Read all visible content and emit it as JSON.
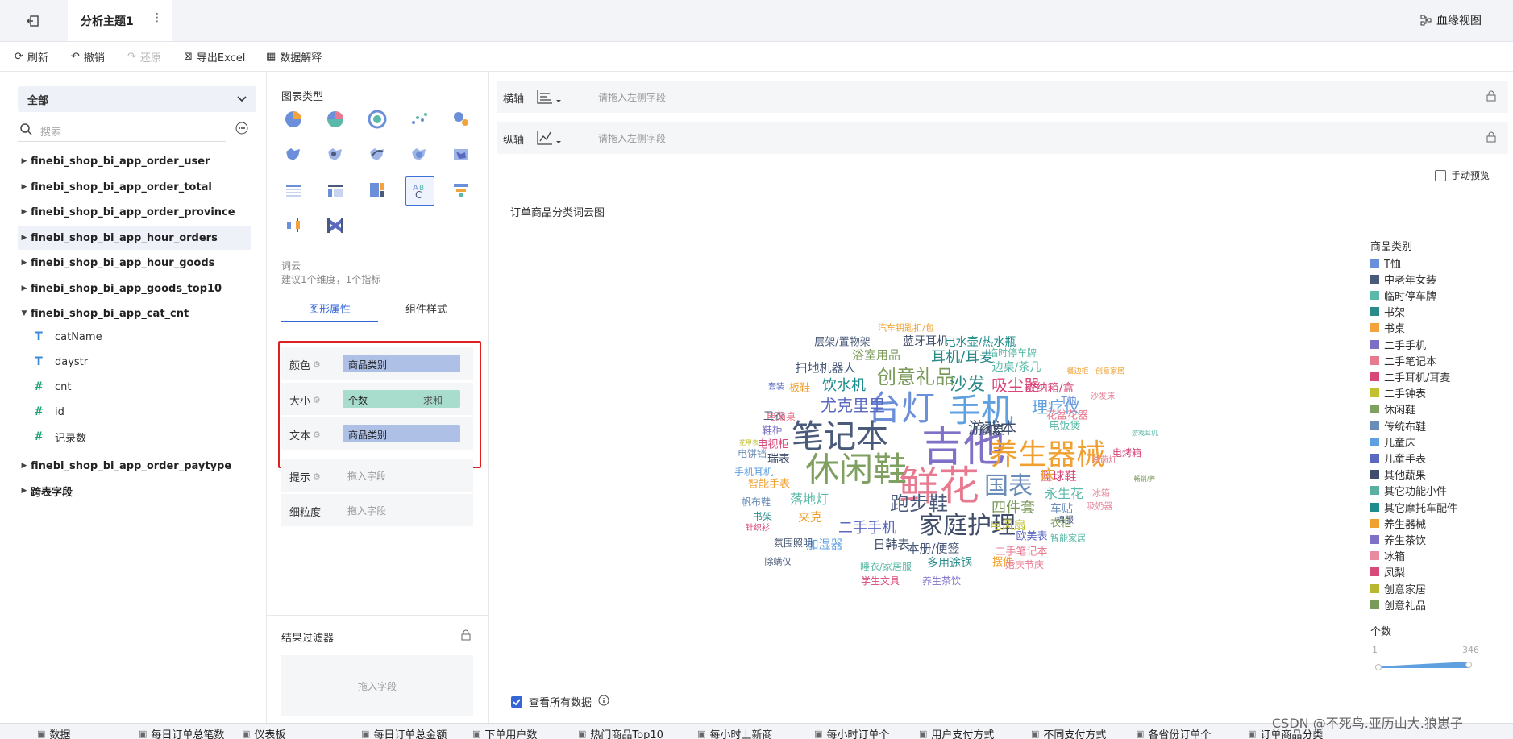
{
  "topbar": {
    "title": "分析主题1",
    "more": "⋮",
    "lineage": "血缘视图"
  },
  "toolbar": {
    "refresh": "刷新",
    "undo": "撤销",
    "redo": "还原",
    "export": "导出Excel",
    "explain": "数据解释"
  },
  "left": {
    "scope": "全部",
    "search_placeholder": "搜索",
    "tables": [
      "finebi_shop_bi_app_order_user",
      "finebi_shop_bi_app_order_total",
      "finebi_shop_bi_app_order_province",
      "finebi_shop_bi_app_hour_orders",
      "finebi_shop_bi_app_hour_goods",
      "finebi_shop_bi_app_goods_top10",
      "finebi_shop_bi_app_cat_cnt"
    ],
    "fields": [
      "catName",
      "daystr",
      "cnt",
      "id",
      "记录数"
    ],
    "tables_after": [
      "finebi_shop_bi_app_order_paytype",
      "跨表字段"
    ]
  },
  "mid": {
    "chart_type_label": "图表类型",
    "wordcloud_name": "词云",
    "wordcloud_tip": "建议1个维度，1个指标",
    "tab_props": "图形属性",
    "tab_style": "组件样式",
    "color_label": "颜色",
    "color_value": "商品类别",
    "size_label": "大小",
    "size_value": "个数",
    "size_agg": "求和",
    "text_label": "文本",
    "text_value": "商品类别",
    "tip_label": "提示",
    "tip_placeholder": "拖入字段",
    "grain_label": "细粒度",
    "grain_placeholder": "拖入字段",
    "filter_title": "结果过滤器",
    "filter_placeholder": "拖入字段"
  },
  "canvas": {
    "x_axis_label": "横轴",
    "y_axis_label": "纵轴",
    "axis_placeholder": "请拖入左侧字段",
    "manual_preview": "手动预览",
    "chart_title": "订单商品分类词云图",
    "legend_title": "商品类别",
    "size_title": "个数",
    "size_min": "1",
    "size_max": "346",
    "view_all": "查看所有数据"
  },
  "legend": [
    {
      "label": "T恤",
      "color": "#6b8fd8"
    },
    {
      "label": "中老年女装",
      "color": "#4a5a7a"
    },
    {
      "label": "临时停车牌",
      "color": "#5ab9a8"
    },
    {
      "label": "书架",
      "color": "#2a8a8a"
    },
    {
      "label": "书桌",
      "color": "#f3a33b"
    },
    {
      "label": "二手手机",
      "color": "#7a6fc4"
    },
    {
      "label": "二手笔记本",
      "color": "#e87a90"
    },
    {
      "label": "二手耳机/耳麦",
      "color": "#d9467a"
    },
    {
      "label": "二手钟表",
      "color": "#c0c030"
    },
    {
      "label": "休闲鞋",
      "color": "#7fa060"
    },
    {
      "label": "传统布鞋",
      "color": "#6a8cb8"
    },
    {
      "label": "儿童床",
      "color": "#5fa0e0"
    },
    {
      "label": "儿童手表",
      "color": "#5a68c0"
    },
    {
      "label": "其他蔬果",
      "color": "#3f4d6a"
    },
    {
      "label": "其它功能小件",
      "color": "#5ab0a0"
    },
    {
      "label": "其它摩托车配件",
      "color": "#1f8c8c"
    },
    {
      "label": "养生器械",
      "color": "#f0a030"
    },
    {
      "label": "养生茶饮",
      "color": "#8070c8"
    },
    {
      "label": "冰箱",
      "color": "#e88aa0"
    },
    {
      "label": "凤梨",
      "color": "#d84a7c"
    },
    {
      "label": "创意家居",
      "color": "#b8b830"
    },
    {
      "label": "创意礼品",
      "color": "#7a9a5a"
    }
  ],
  "wordcloud": [
    {
      "text": "吉他",
      "size": 52,
      "color": "#8070c8"
    },
    {
      "text": "鲜花",
      "size": 50,
      "color": "#e87a90"
    },
    {
      "text": "台灯",
      "size": 42,
      "color": "#6b8fd8"
    },
    {
      "text": "手机",
      "size": 40,
      "color": "#5fa0e0"
    },
    {
      "text": "休闲鞋",
      "size": 42,
      "color": "#7fa060"
    },
    {
      "text": "笔记本",
      "size": 40,
      "color": "#4a5a7a"
    },
    {
      "text": "养生器械",
      "size": 36,
      "color": "#f0a030"
    },
    {
      "text": "家庭护理",
      "size": 30,
      "color": "#3f4d6a"
    },
    {
      "text": "国表",
      "size": 30,
      "color": "#6a8cb8"
    },
    {
      "text": "跑步鞋",
      "size": 24,
      "color": "#4a5a7a"
    },
    {
      "text": "创意礼品",
      "size": 24,
      "color": "#7a9a5a"
    },
    {
      "text": "尤克里里",
      "size": 20,
      "color": "#5a68c0"
    },
    {
      "text": "沙发",
      "size": 22,
      "color": "#2a8a8a"
    },
    {
      "text": "吸尘器",
      "size": 20,
      "color": "#d9467a"
    },
    {
      "text": "游戏本",
      "size": 20,
      "color": "#3f4d6a"
    },
    {
      "text": "理疗仪",
      "size": 20,
      "color": "#5fa0e0"
    },
    {
      "text": "耳机/耳麦",
      "size": 18,
      "color": "#2a8a8a"
    },
    {
      "text": "饮水机",
      "size": 18,
      "color": "#1f8c8c"
    },
    {
      "text": "四件套",
      "size": 18,
      "color": "#7a9a5a"
    },
    {
      "text": "永生花",
      "size": 16,
      "color": "#5ab9a8"
    },
    {
      "text": "二手手机",
      "size": 18,
      "color": "#5a68c0"
    },
    {
      "text": "扫地机器人",
      "size": 15,
      "color": "#4a5a7a"
    },
    {
      "text": "浴室用品",
      "size": 15,
      "color": "#7a9a5a"
    },
    {
      "text": "蓝牙耳机",
      "size": 14,
      "color": "#3f4d6a"
    },
    {
      "text": "电水壶/热水瓶",
      "size": 14,
      "color": "#1f8c8c"
    },
    {
      "text": "层架/置物架",
      "size": 13,
      "color": "#4a5a7a"
    },
    {
      "text": "边桌/茶几",
      "size": 14,
      "color": "#5ab9a8"
    },
    {
      "text": "收纳箱/盒",
      "size": 14,
      "color": "#d9467a"
    },
    {
      "text": "篮球鞋",
      "size": 15,
      "color": "#d9467a"
    },
    {
      "text": "床",
      "size": 18,
      "color": "#f0a030"
    },
    {
      "text": "餐桌",
      "size": 15,
      "color": "#3f4d6a"
    },
    {
      "text": "电饭煲",
      "size": 13,
      "color": "#5ab9a8"
    },
    {
      "text": "花盆花器",
      "size": 13,
      "color": "#e87a90"
    },
    {
      "text": "车贴",
      "size": 14,
      "color": "#6a8cb8"
    },
    {
      "text": "落地灯",
      "size": 16,
      "color": "#5ab9a8"
    },
    {
      "text": "夹克",
      "size": 15,
      "color": "#f0a030"
    },
    {
      "text": "加湿器",
      "size": 15,
      "color": "#5fa0e0"
    },
    {
      "text": "日韩表",
      "size": 15,
      "color": "#3f4d6a"
    },
    {
      "text": "本册/便签",
      "size": 15,
      "color": "#4a5a7a"
    },
    {
      "text": "电风扇",
      "size": 15,
      "color": "#c0c030"
    },
    {
      "text": "衣柜",
      "size": 13,
      "color": "#7a9a5a"
    },
    {
      "text": "欧美表",
      "size": 13,
      "color": "#5a68c0"
    },
    {
      "text": "二手笔记本",
      "size": 13,
      "color": "#e87a90"
    },
    {
      "text": "多用途锅",
      "size": 14,
      "color": "#2a8a8a"
    },
    {
      "text": "摆件",
      "size": 13,
      "color": "#f0a030"
    },
    {
      "text": "瑞表",
      "size": 14,
      "color": "#3f4d6a"
    },
    {
      "text": "电视柜",
      "size": 13,
      "color": "#d9467a"
    },
    {
      "text": "鞋柜",
      "size": 13,
      "color": "#7a6fc4"
    },
    {
      "text": "卫衣",
      "size": 13,
      "color": "#4a5a7a"
    },
    {
      "text": "板鞋",
      "size": 13,
      "color": "#f0a030"
    },
    {
      "text": "智能手表",
      "size": 13,
      "color": "#f0a030"
    },
    {
      "text": "帆布鞋",
      "size": 12,
      "color": "#6a8cb8"
    },
    {
      "text": "书架",
      "size": 12,
      "color": "#2a8a8a"
    },
    {
      "text": "氛围照明",
      "size": 12,
      "color": "#3f4d6a"
    },
    {
      "text": "睡衣/家居服",
      "size": 12,
      "color": "#5ab9a8"
    },
    {
      "text": "学生文具",
      "size": 12,
      "color": "#d9467a"
    },
    {
      "text": "养生茶饮",
      "size": 12,
      "color": "#8070c8"
    },
    {
      "text": "婚庆节庆",
      "size": 12,
      "color": "#e87a90"
    },
    {
      "text": "智能家居",
      "size": 11,
      "color": "#5ab9a8"
    },
    {
      "text": "冰箱",
      "size": 11,
      "color": "#e88aa0"
    },
    {
      "text": "吸奶器",
      "size": 11,
      "color": "#e88aa0"
    },
    {
      "text": "棉服",
      "size": 11,
      "color": "#4a5a7a"
    },
    {
      "text": "电烤箱",
      "size": 12,
      "color": "#d9467a"
    },
    {
      "text": "汽车钥匙扣/包",
      "size": 11,
      "color": "#f0a030"
    },
    {
      "text": "临时停车牌",
      "size": 12,
      "color": "#5ab9a8"
    },
    {
      "text": "电脑桌",
      "size": 12,
      "color": "#e87a90"
    },
    {
      "text": "手机耳机",
      "size": 12,
      "color": "#5fa0e0"
    },
    {
      "text": "电饼铛",
      "size": 12,
      "color": "#6a8cb8"
    },
    {
      "text": "针织衫",
      "size": 10,
      "color": "#d9467a"
    },
    {
      "text": "除螨仪",
      "size": 11,
      "color": "#4a5a7a"
    },
    {
      "text": "套装",
      "size": 10,
      "color": "#5a68c0"
    },
    {
      "text": "T恤",
      "size": 12,
      "color": "#6b8fd8"
    },
    {
      "text": "沙发床",
      "size": 10,
      "color": "#e87a90"
    },
    {
      "text": "杀菌灯",
      "size": 10,
      "color": "#e87a90"
    },
    {
      "text": "创意家居",
      "size": 9,
      "color": "#f0a030"
    },
    {
      "text": "餐边柜",
      "size": 9,
      "color": "#f0a030"
    },
    {
      "text": "游戏耳机",
      "size": 8,
      "color": "#5ab9a8"
    },
    {
      "text": "畅销/养",
      "size": 8,
      "color": "#7a9a5a"
    },
    {
      "text": "花甲表",
      "size": 8,
      "color": "#c0c030"
    }
  ],
  "bottom_tabs": [
    "数据",
    "每日订单总笔数",
    "仪表板",
    "每日订单总金额",
    "下单用户数",
    "热门商品Top10",
    "每小时上新商",
    "每小时订单个",
    "用户支付方式",
    "不同支付方式",
    "各省份订单个",
    "订单商品分类"
  ],
  "watermark": "CSDN @不死鸟.亚历山大.狼崽子"
}
